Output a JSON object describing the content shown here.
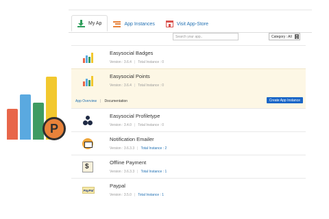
{
  "tabs": [
    {
      "label": "My Ap",
      "icon": "download-icon"
    },
    {
      "label": "App Instances",
      "icon": "list-icon"
    },
    {
      "label": "Visit App-Store",
      "icon": "store-icon"
    }
  ],
  "search": {
    "placeholder": "Search your app.."
  },
  "category": {
    "value": "Category : All"
  },
  "apps": [
    {
      "name": "Easysocial Badges",
      "version": "Version : 3.6.4",
      "instances": "Total Instance : 0"
    },
    {
      "name": "Easysocial Points",
      "version": "Version : 3.6.4",
      "instances": "Total Instance : 0",
      "overview_link": "App Overview",
      "docs_link": "Documentation",
      "create_button": "Create App Instance"
    },
    {
      "name": "Easysocial Profiletype",
      "version": "Version : 3.4.0",
      "instances": "Total Instance : 0"
    },
    {
      "name": "Notification Emailer",
      "version": "Version : 3.6.3.3",
      "instances": "Total Instance : 2"
    },
    {
      "name": "Offline Payment",
      "version": "Version : 3.6.3.3",
      "instances": "Total Instance : 1"
    },
    {
      "name": "Paypal",
      "version": "Version : 3.5.0",
      "instances": "Total Instance : 1",
      "icon_text": "PayPal"
    }
  ],
  "big_logo": {
    "badge_letter": "P"
  },
  "colors": {
    "link": "#1f6fb2",
    "button": "#1a66c7",
    "highlight": "#fdf7e5"
  }
}
